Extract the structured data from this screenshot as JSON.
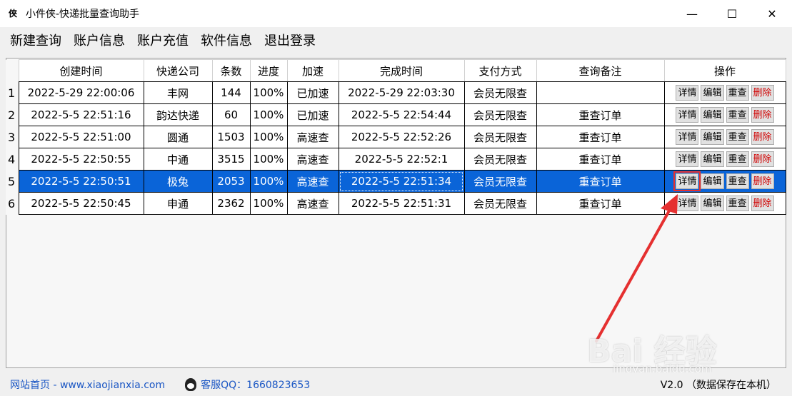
{
  "window": {
    "title": "小件侠-快递批量查询助手",
    "app_icon": "侠",
    "minimize": "—",
    "maximize": "☐",
    "close": "✕"
  },
  "menu": [
    "新建查询",
    "账户信息",
    "账户充值",
    "软件信息",
    "退出登录"
  ],
  "table": {
    "columns": [
      "创建时间",
      "快递公司",
      "条数",
      "进度",
      "加速",
      "完成时间",
      "支付方式",
      "查询备注",
      "操作"
    ],
    "selected_row": 5,
    "action_labels": {
      "detail": "详情",
      "edit": "编辑",
      "requery": "重查",
      "delete": "删除"
    },
    "rows": [
      {
        "num": "1",
        "created": "2022-5-29 22:00:06",
        "company": "丰网",
        "count": "144",
        "progress": "100%",
        "speed": "已加速",
        "finished": "2022-5-29 22:03:30",
        "pay": "会员无限查",
        "note": ""
      },
      {
        "num": "2",
        "created": "2022-5-5 22:51:16",
        "company": "韵达快递",
        "count": "60",
        "progress": "100%",
        "speed": "已加速",
        "finished": "2022-5-5 22:54:44",
        "pay": "会员无限查",
        "note": "重查订单"
      },
      {
        "num": "3",
        "created": "2022-5-5 22:51:00",
        "company": "圆通",
        "count": "1503",
        "progress": "100%",
        "speed": "高速查",
        "finished": "2022-5-5 22:52:26",
        "pay": "会员无限查",
        "note": "重查订单"
      },
      {
        "num": "4",
        "created": "2022-5-5 22:50:55",
        "company": "中通",
        "count": "3515",
        "progress": "100%",
        "speed": "高速查",
        "finished": "2022-5-5 22:52:1",
        "pay": "会员无限查",
        "note": "重查订单"
      },
      {
        "num": "5",
        "created": "2022-5-5 22:50:51",
        "company": "极兔",
        "count": "2053",
        "progress": "100%",
        "speed": "高速查",
        "finished": "2022-5-5 22:51:34",
        "pay": "会员无限查",
        "note": "重查订单"
      },
      {
        "num": "6",
        "created": "2022-5-5 22:50:45",
        "company": "申通",
        "count": "2362",
        "progress": "100%",
        "speed": "高速查",
        "finished": "2022-5-5 22:51:31",
        "pay": "会员无限查",
        "note": "重查订单"
      }
    ]
  },
  "status": {
    "site": "网站首页 - www.xiaojianxia.com",
    "qq": "客服QQ：1660823653",
    "version": "V2.0 （数据保存在本机）"
  },
  "watermark": {
    "main": "Bai 经验",
    "sub": "jingyan.baidu.com"
  },
  "colors": {
    "selection": "#0a64d8",
    "link": "#1a56c4",
    "delete_text": "#d00000",
    "annotation": "#e53030"
  }
}
